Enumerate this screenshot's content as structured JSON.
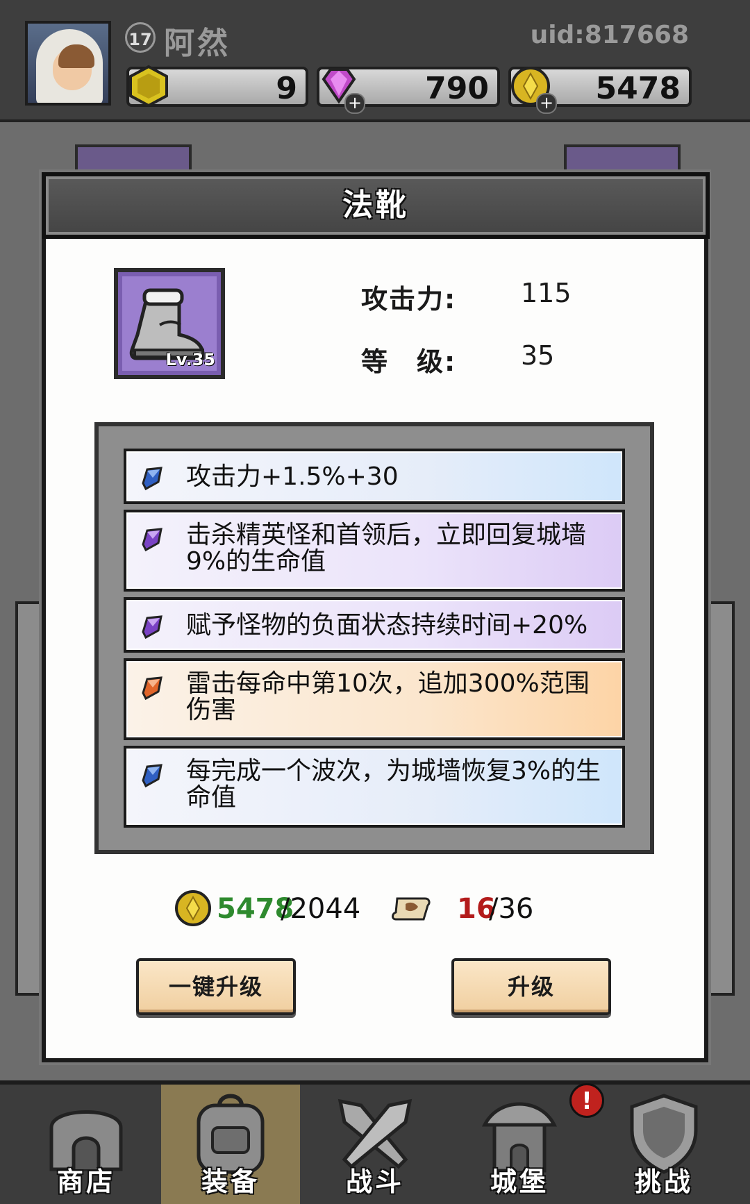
{
  "player": {
    "level": "17",
    "name": "阿然",
    "uid": "uid:817668"
  },
  "resources": {
    "stamina": "9",
    "diamonds": "790",
    "gold": "5478"
  },
  "dialog": {
    "title": "法靴",
    "item_level": "Lv.35",
    "stats": [
      {
        "label": "攻击力:",
        "value": "115"
      },
      {
        "label": "等　级:",
        "value": "35"
      }
    ],
    "affixes": [
      {
        "text": "攻击力+1.5%+30",
        "rarity": "blue"
      },
      {
        "text": "击杀精英怪和首领后，立即回复城墙9%的生命值",
        "rarity": "purple"
      },
      {
        "text": "赋予怪物的负面状态持续时间+20%",
        "rarity": "purple"
      },
      {
        "text": "雷击每命中第10次，追加300%范围伤害",
        "rarity": "orange"
      },
      {
        "text": "每完成一个波次，为城墙恢复3%的生命值",
        "rarity": "blue"
      }
    ],
    "cost": {
      "gold_have": "5478",
      "gold_need": "/2044",
      "scroll_have": "16",
      "scroll_need": "/36"
    },
    "buttons": {
      "auto_upgrade": "一键升级",
      "upgrade": "升级"
    }
  },
  "nav": {
    "items": [
      {
        "label": "商店",
        "icon": "shop-icon"
      },
      {
        "label": "装备",
        "icon": "backpack-icon"
      },
      {
        "label": "战斗",
        "icon": "crossed-swords-icon"
      },
      {
        "label": "城堡",
        "icon": "castle-icon"
      },
      {
        "label": "挑战",
        "icon": "shield-icon"
      }
    ],
    "alert": "!",
    "active": "装备"
  },
  "colors": {
    "gem_blue": "#2f5fc2",
    "gem_purple": "#7a42c4",
    "gem_orange": "#e0652a",
    "gold_have": "#2e8a2e",
    "scroll_have": "#b31b1b"
  }
}
